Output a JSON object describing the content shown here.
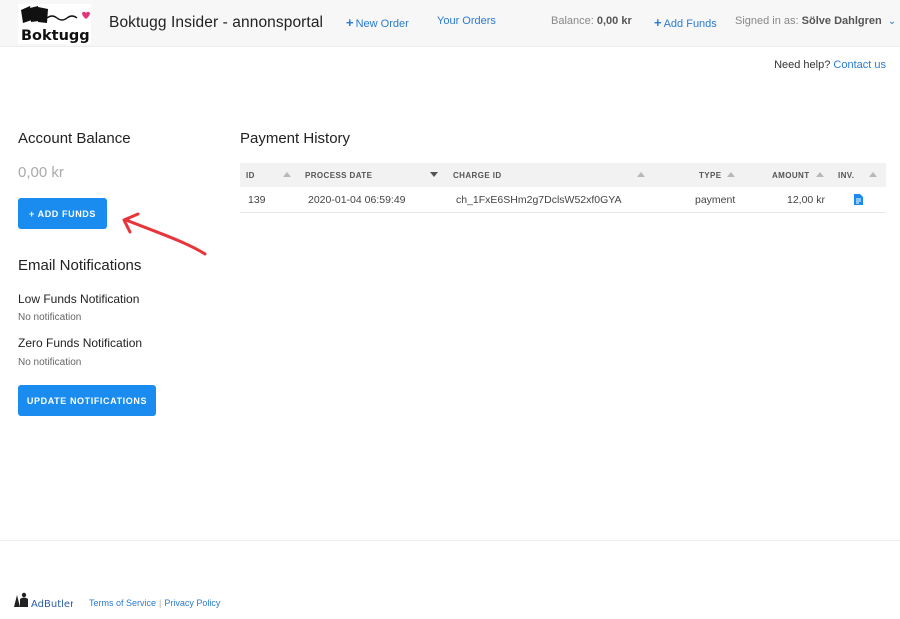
{
  "header": {
    "logo_text": "Boktugg",
    "title": "Boktugg Insider - annonsportal",
    "new_order": "New Order",
    "your_orders": "Your Orders",
    "balance_label": "Balance:",
    "balance_value": "0,00 kr",
    "add_funds": "Add Funds",
    "signed_in_label": "Signed in as:",
    "user_name": "Sölve Dahlgren"
  },
  "help": {
    "text": "Need help?",
    "link": "Contact us"
  },
  "account": {
    "title": "Account Balance",
    "balance": "0,00 kr",
    "add_funds_button": "+ ADD FUNDS"
  },
  "notifications": {
    "title": "Email Notifications",
    "low_label": "Low Funds Notification",
    "low_value": "No notification",
    "zero_label": "Zero Funds Notification",
    "zero_value": "No notification",
    "update_button": "UPDATE NOTIFICATIONS"
  },
  "payments": {
    "title": "Payment History",
    "columns": [
      "ID",
      "PROCESS DATE",
      "CHARGE ID",
      "TYPE",
      "AMOUNT",
      "INV."
    ],
    "rows": [
      {
        "id": "139",
        "date": "2020-01-04 06:59:49",
        "charge_id": "ch_1FxE6SHm2g7DclsW52xf0GYA",
        "type": "payment",
        "amount": "12,00 kr"
      }
    ]
  },
  "footer": {
    "brand": "AdButler",
    "terms": "Terms of Service",
    "privacy": "Privacy Policy"
  },
  "colors": {
    "accent": "#1a8cf0",
    "link": "#2a7bd1",
    "annotation_arrow": "#e8343b"
  }
}
